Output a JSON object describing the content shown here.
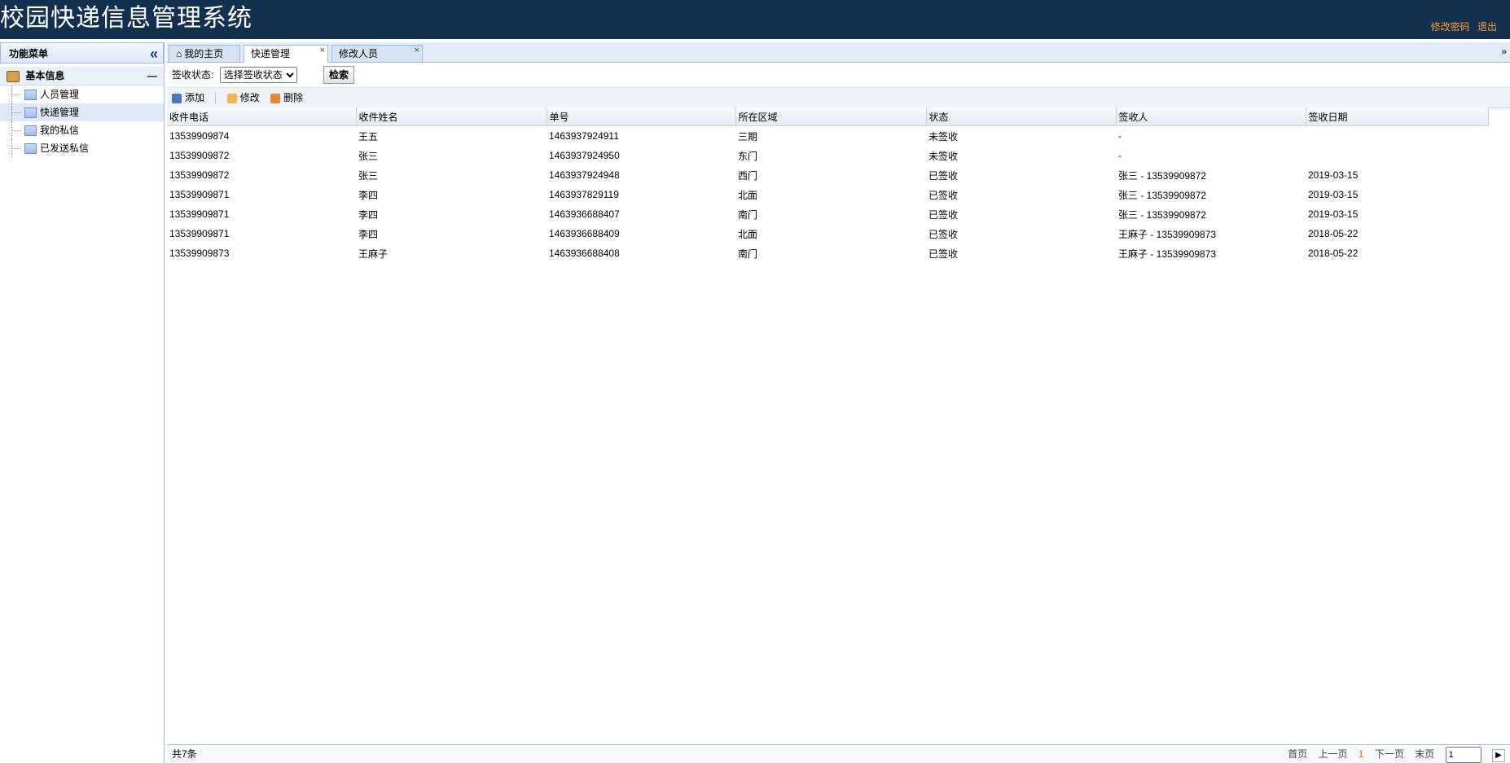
{
  "app": {
    "title": "校园快递信息管理系统",
    "change_password": "修改密码",
    "logout": "退出"
  },
  "sidebar": {
    "title": "功能菜单",
    "collapse_icon": "«",
    "group": {
      "label": "基本信息",
      "toggle": "—"
    },
    "items": [
      {
        "label": "人员管理"
      },
      {
        "label": "快递管理"
      },
      {
        "label": "我的私信"
      },
      {
        "label": "已发送私信"
      }
    ]
  },
  "tabs": [
    {
      "label": "我的主页",
      "icon": "home-icon"
    },
    {
      "label": "快递管理",
      "close": "×"
    },
    {
      "label": "修改人员",
      "close": "×"
    }
  ],
  "tabs_menu_icon": "chevron-down-icon",
  "search": {
    "label": "签收状态:",
    "selected": "选择签收状态",
    "button": "检索"
  },
  "toolbar": {
    "add": "添加",
    "edit": "修改",
    "delete": "删除"
  },
  "table": {
    "columns": [
      "收件电话",
      "收件姓名",
      "单号",
      "所在区域",
      "状态",
      "签收人",
      "签收日期"
    ],
    "rows": [
      [
        "13539909874",
        "王五",
        "1463937924911",
        "三期",
        "未签收",
        "-",
        ""
      ],
      [
        "13539909872",
        "张三",
        "1463937924950",
        "东门",
        "未签收",
        "-",
        ""
      ],
      [
        "13539909872",
        "张三",
        "1463937924948",
        "西门",
        "已签收",
        "张三 - 13539909872",
        "2019-03-15"
      ],
      [
        "13539909871",
        "李四",
        "1463937829119",
        "北面",
        "已签收",
        "张三 - 13539909872",
        "2019-03-15"
      ],
      [
        "13539909871",
        "李四",
        "1463936688407",
        "南门",
        "已签收",
        "张三 - 13539909872",
        "2019-03-15"
      ],
      [
        "13539909871",
        "李四",
        "1463936688409",
        "北面",
        "已签收",
        "王麻子 - 13539909873",
        "2018-05-22"
      ],
      [
        "13539909873",
        "王麻子",
        "1463936688408",
        "南门",
        "已签收",
        "王麻子 - 13539909873",
        "2018-05-22"
      ]
    ]
  },
  "footer": {
    "total": "共7条",
    "first": "首页",
    "prev": "上一页",
    "current": "1",
    "next": "下一页",
    "last": "末页",
    "page_input": "1"
  },
  "colors": {
    "header_bg": "#14304f",
    "link_orange": "#ff9933",
    "border_blue": "#99bbe8"
  }
}
